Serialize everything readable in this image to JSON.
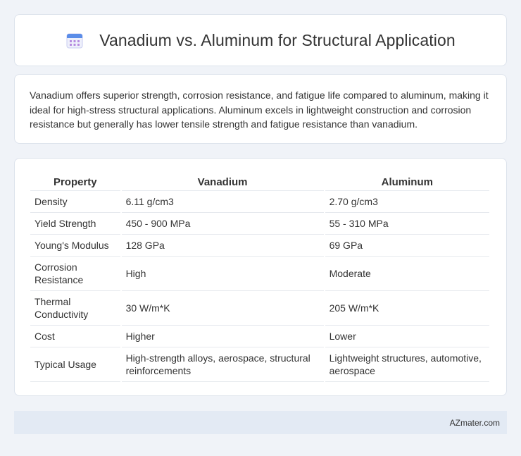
{
  "header": {
    "icon": "calendar-icon",
    "title": "Vanadium vs. Aluminum for Structural Application"
  },
  "summary": {
    "text": "Vanadium offers superior strength, corrosion resistance, and fatigue life compared to aluminum, making it ideal for high-stress structural applications. Aluminum excels in lightweight construction and corrosion resistance but generally has lower tensile strength and fatigue resistance than vanadium."
  },
  "table": {
    "headers": [
      "Property",
      "Vanadium",
      "Aluminum"
    ],
    "rows": [
      [
        "Density",
        "6.11 g/cm3",
        "2.70 g/cm3"
      ],
      [
        "Yield Strength",
        "450 - 900 MPa",
        "55 - 310 MPa"
      ],
      [
        "Young's Modulus",
        "128 GPa",
        "69 GPa"
      ],
      [
        "Corrosion Resistance",
        "High",
        "Moderate"
      ],
      [
        "Thermal Conductivity",
        "30 W/m*K",
        "205 W/m*K"
      ],
      [
        "Cost",
        "Higher",
        "Lower"
      ],
      [
        "Typical Usage",
        "High-strength alloys, aerospace, structural reinforcements",
        "Lightweight structures, automotive, aerospace"
      ]
    ]
  },
  "footer": {
    "text": "AZmater.com"
  },
  "colors": {
    "page_bg": "#f0f3f8",
    "card_bg": "#ffffff",
    "footer_bg": "#e3eaf4",
    "text": "#333333"
  }
}
